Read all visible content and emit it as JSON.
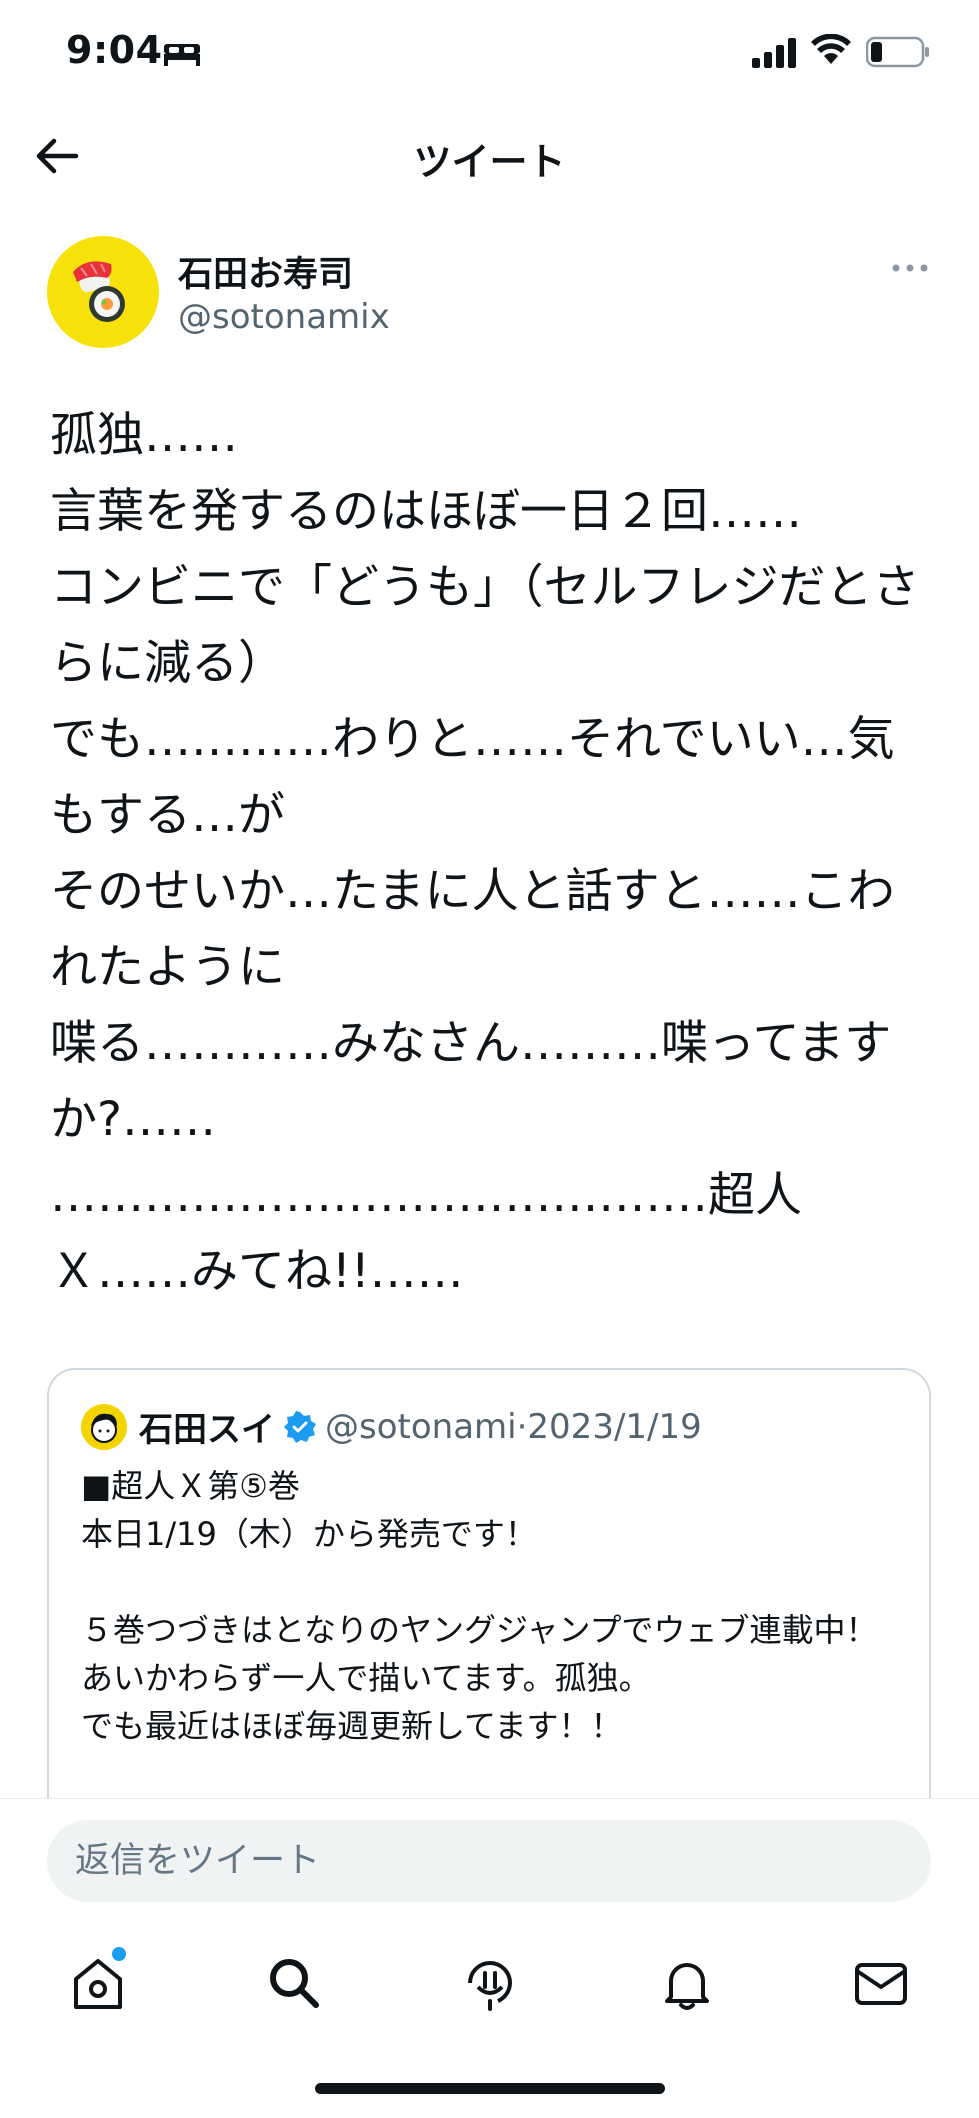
{
  "status_bar": {
    "time": "9:04",
    "icons": [
      "bed-icon",
      "signal-icon",
      "wifi-icon",
      "battery-icon"
    ]
  },
  "header": {
    "title": "ツイート",
    "back_icon": "arrow-left-icon"
  },
  "tweet": {
    "author_name": "石田お寿司",
    "author_handle": "@sotonamix",
    "avatar_icon": "sushi-icon",
    "body": "孤独……\n言葉を発するのはほぼ一日２回……\nコンビニで「どうも」（セルフレジだとさらに減る）\nでも…………わりと……それでいい…気もする…が\nそのせいか…たまに人と話すと……こわれたように\n喋る…………みなさん………喋ってますか?……\n……………………………………超人Ｘ……みてね!!……"
  },
  "quote_tweet": {
    "author_name": "石田スイ",
    "author_handle": "@sotonami",
    "separator": "·",
    "date": "2023/1/19",
    "verified": true,
    "text": "■超人Ｘ第⑤巻\n本日1/19（木）から発売です！\n\n５巻つづきはとなりのヤングジャンプでウェブ連載中！\nあいかわらず一人で描いてます。孤独。\nでも最近はほぼ毎週更新してます！！"
  },
  "reply": {
    "placeholder": "返信をツイート"
  },
  "bottom_nav": {
    "items": [
      "home-icon",
      "search-icon",
      "spaces-icon",
      "notifications-icon",
      "messages-icon"
    ],
    "home_has_badge": true
  },
  "colors": {
    "accent": "#1d9bf0",
    "text": "#0f1419",
    "secondary_text": "#536471",
    "reply_bg": "#eff3f4",
    "avatar_bg": "#f7e10b"
  }
}
